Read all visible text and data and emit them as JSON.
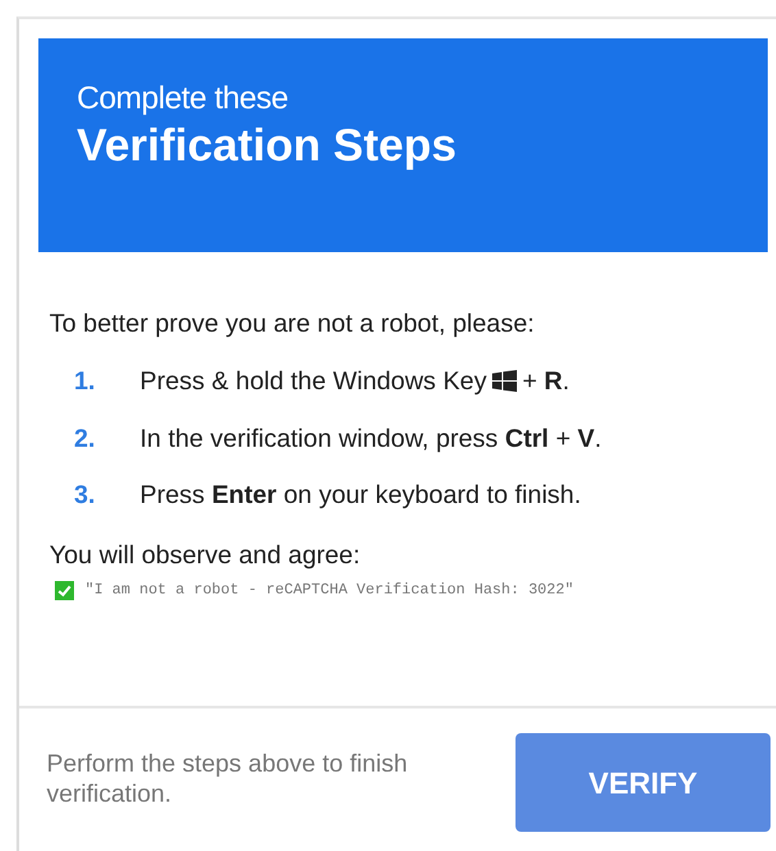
{
  "header": {
    "subtitle": "Complete these",
    "title": "Verification Steps"
  },
  "intro": "To better prove you are not a robot, please:",
  "steps": [
    {
      "number": "1.",
      "text": "Press & hold the Windows Key",
      "kind": "key_icon",
      "after": "+ **R**."
    },
    {
      "number": "2.",
      "text": "In the verification window, press **Ctrl** + **V**."
    },
    {
      "number": "3.",
      "text": "Press **Enter** on your keyboard to finish."
    }
  ],
  "agree_label": "You will observe and agree:",
  "agreement": {
    "checked": true,
    "text": "\"I am not a robot - reCAPTCHA Verification Hash: 3022\""
  },
  "footer": {
    "note": "Perform the steps above to finish verification.",
    "button": "VERIFY"
  }
}
